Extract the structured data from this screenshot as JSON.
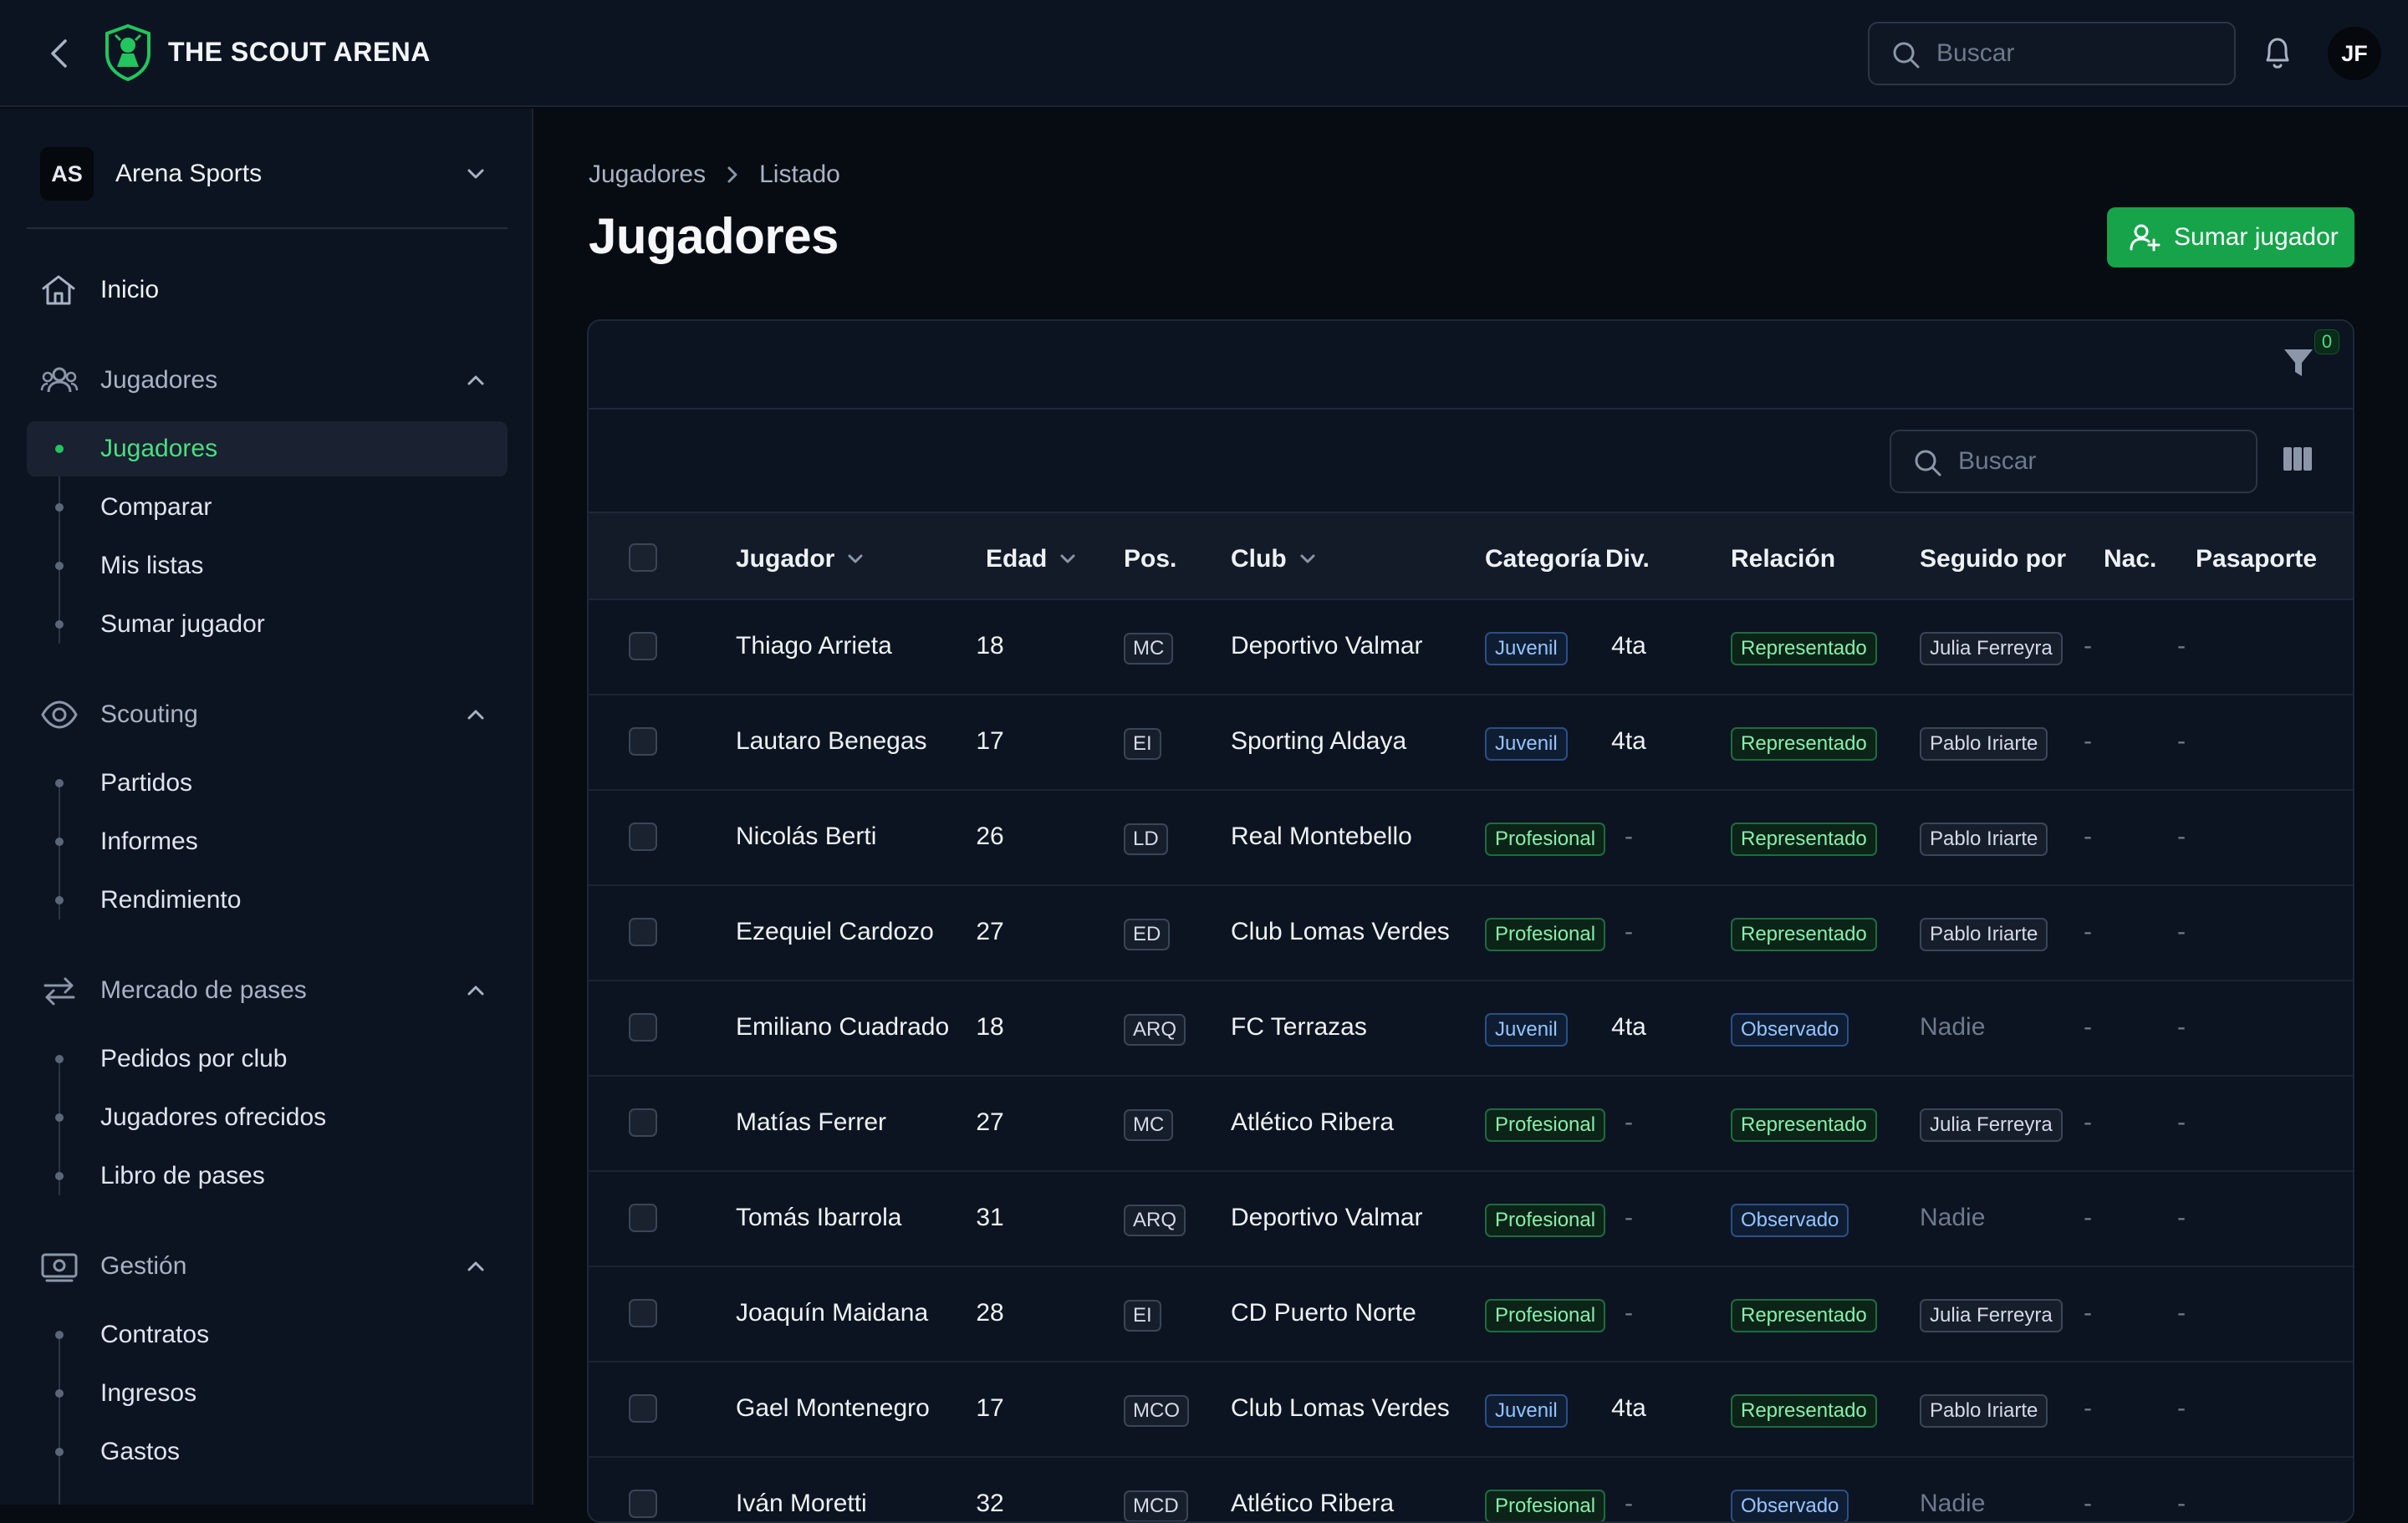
{
  "header": {
    "brand": "THE SCOUT ARENA",
    "search_placeholder": "Buscar",
    "user_initials": "JF"
  },
  "sidebar": {
    "org": {
      "initials": "AS",
      "name": "Arena Sports"
    },
    "home": "Inicio",
    "groups": [
      {
        "label": "Jugadores",
        "items": [
          "Jugadores",
          "Comparar",
          "Mis listas",
          "Sumar jugador"
        ]
      },
      {
        "label": "Scouting",
        "items": [
          "Partidos",
          "Informes",
          "Rendimiento"
        ]
      },
      {
        "label": "Mercado de pases",
        "items": [
          "Pedidos por club",
          "Jugadores ofrecidos",
          "Libro de pases"
        ]
      },
      {
        "label": "Gestión",
        "items": [
          "Contratos",
          "Ingresos",
          "Gastos"
        ]
      }
    ],
    "active_item": "Jugadores"
  },
  "breadcrumb": [
    "Jugadores",
    "Listado"
  ],
  "page_title": "Jugadores",
  "add_button_label": "Sumar jugador",
  "filter_count": "0",
  "table_search_placeholder": "Buscar",
  "table": {
    "columns": [
      "Jugador",
      "Edad",
      "Pos.",
      "Club",
      "Categoría",
      "Div.",
      "Relación",
      "Seguido por",
      "Nac.",
      "Pasaporte"
    ],
    "rows": [
      {
        "player": "Thiago Arrieta",
        "age": "18",
        "pos": "MC",
        "club": "Deportivo Valmar",
        "category": "Juvenil",
        "div": "4ta",
        "relation": "Representado",
        "followed_by": "Julia Ferreyra",
        "nac": "-",
        "passport": "-"
      },
      {
        "player": "Lautaro Benegas",
        "age": "17",
        "pos": "EI",
        "club": "Sporting Aldaya",
        "category": "Juvenil",
        "div": "4ta",
        "relation": "Representado",
        "followed_by": "Pablo Iriarte",
        "nac": "-",
        "passport": "-"
      },
      {
        "player": "Nicolás Berti",
        "age": "26",
        "pos": "LD",
        "club": "Real Montebello",
        "category": "Profesional",
        "div": "-",
        "relation": "Representado",
        "followed_by": "Pablo Iriarte",
        "nac": "-",
        "passport": "-"
      },
      {
        "player": "Ezequiel Cardozo",
        "age": "27",
        "pos": "ED",
        "club": "Club Lomas Verdes",
        "category": "Profesional",
        "div": "-",
        "relation": "Representado",
        "followed_by": "Pablo Iriarte",
        "nac": "-",
        "passport": "-"
      },
      {
        "player": "Emiliano Cuadrado",
        "age": "18",
        "pos": "ARQ",
        "club": "FC Terrazas",
        "category": "Juvenil",
        "div": "4ta",
        "relation": "Observado",
        "followed_by": "Nadie",
        "nac": "-",
        "passport": "-"
      },
      {
        "player": "Matías Ferrer",
        "age": "27",
        "pos": "MC",
        "club": "Atlético Ribera",
        "category": "Profesional",
        "div": "-",
        "relation": "Representado",
        "followed_by": "Julia Ferreyra",
        "nac": "-",
        "passport": "-"
      },
      {
        "player": "Tomás Ibarrola",
        "age": "31",
        "pos": "ARQ",
        "club": "Deportivo Valmar",
        "category": "Profesional",
        "div": "-",
        "relation": "Observado",
        "followed_by": "Nadie",
        "nac": "-",
        "passport": "-"
      },
      {
        "player": "Joaquín Maidana",
        "age": "28",
        "pos": "EI",
        "club": "CD Puerto Norte",
        "category": "Profesional",
        "div": "-",
        "relation": "Representado",
        "followed_by": "Julia Ferreyra",
        "nac": "-",
        "passport": "-"
      },
      {
        "player": "Gael Montenegro",
        "age": "17",
        "pos": "MCO",
        "club": "Club Lomas Verdes",
        "category": "Juvenil",
        "div": "4ta",
        "relation": "Representado",
        "followed_by": "Pablo Iriarte",
        "nac": "-",
        "passport": "-"
      },
      {
        "player": "Iván Moretti",
        "age": "32",
        "pos": "MCD",
        "club": "Atlético Ribera",
        "category": "Profesional",
        "div": "-",
        "relation": "Observado",
        "followed_by": "Nadie",
        "nac": "-",
        "passport": "-"
      }
    ]
  },
  "colors": {
    "accent_green": "#16a34a",
    "active_text": "#4ade80",
    "background": "#070b12",
    "panel": "#0d1421"
  },
  "icons": {
    "back": "chevron-left-icon",
    "logo": "shield-logo-icon",
    "search": "search-icon",
    "notifications": "bell-icon",
    "home": "home-icon",
    "players": "users-icon",
    "scouting": "eye-icon",
    "market": "arrows-swap-icon",
    "management": "money-icon",
    "add_player": "user-plus-icon",
    "filter": "filter-icon",
    "columns": "columns-icon"
  }
}
